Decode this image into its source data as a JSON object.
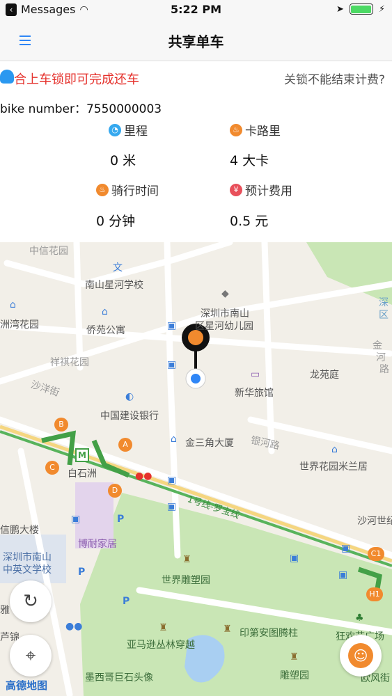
{
  "status_bar": {
    "back_app": "Messages",
    "time": "5:22 PM"
  },
  "nav": {
    "title": "共享单车"
  },
  "lock_bar": {
    "message": "合上车锁即可完成还车",
    "help_link": "关锁不能结束计费?"
  },
  "bike": {
    "number_label": "bike number：",
    "number": "7550000003"
  },
  "stats": [
    {
      "label": "里程",
      "value": "0 米",
      "icon": "mileage-icon",
      "color": "#36a9ef"
    },
    {
      "label": "卡路里",
      "value": "4 大卡",
      "icon": "calorie-icon",
      "color": "#f18a2e"
    },
    {
      "label": "骑行时间",
      "value": "0 分钟",
      "icon": "time-icon",
      "color": "#f18a2e"
    },
    {
      "label": "预计费用",
      "value": "0.5 元",
      "icon": "yen-icon",
      "color": "#e8505b"
    }
  ],
  "map": {
    "labels": [
      "中信花园",
      "南山星河学校",
      "深圳市南山",
      "区星河幼儿园",
      "洲湾花园",
      "侨苑公寓",
      "祥祺花园",
      "沙洋街",
      "龙苑庭",
      "新华旅馆",
      "中国建设银行",
      "金三角大厦",
      "银河路",
      "世界花园米兰居",
      "白石洲",
      "沙河世纪",
      "信鹏大楼",
      "博耐家居",
      "深圳市南山",
      "中英文学校",
      "世界雕塑园",
      "狂欢节广场",
      "亚马逊丛林穿越",
      "印第安图腾柱",
      "墨西哥巨石头像",
      "雕塑园",
      "欧风街",
      "深",
      "区",
      "金",
      "河",
      "路",
      "1号线-罗宝线",
      "芦锦",
      "雅"
    ],
    "station_markers": [
      "A",
      "B",
      "C",
      "D",
      "C1",
      "H1"
    ],
    "metro_badge": "M"
  },
  "map_logo": "高德地图",
  "colors": {
    "accent": "#2f86f6",
    "warning": "#e5322d",
    "orange": "#f18a2e",
    "park": "#c9e6b5",
    "road": "#ffffff"
  }
}
